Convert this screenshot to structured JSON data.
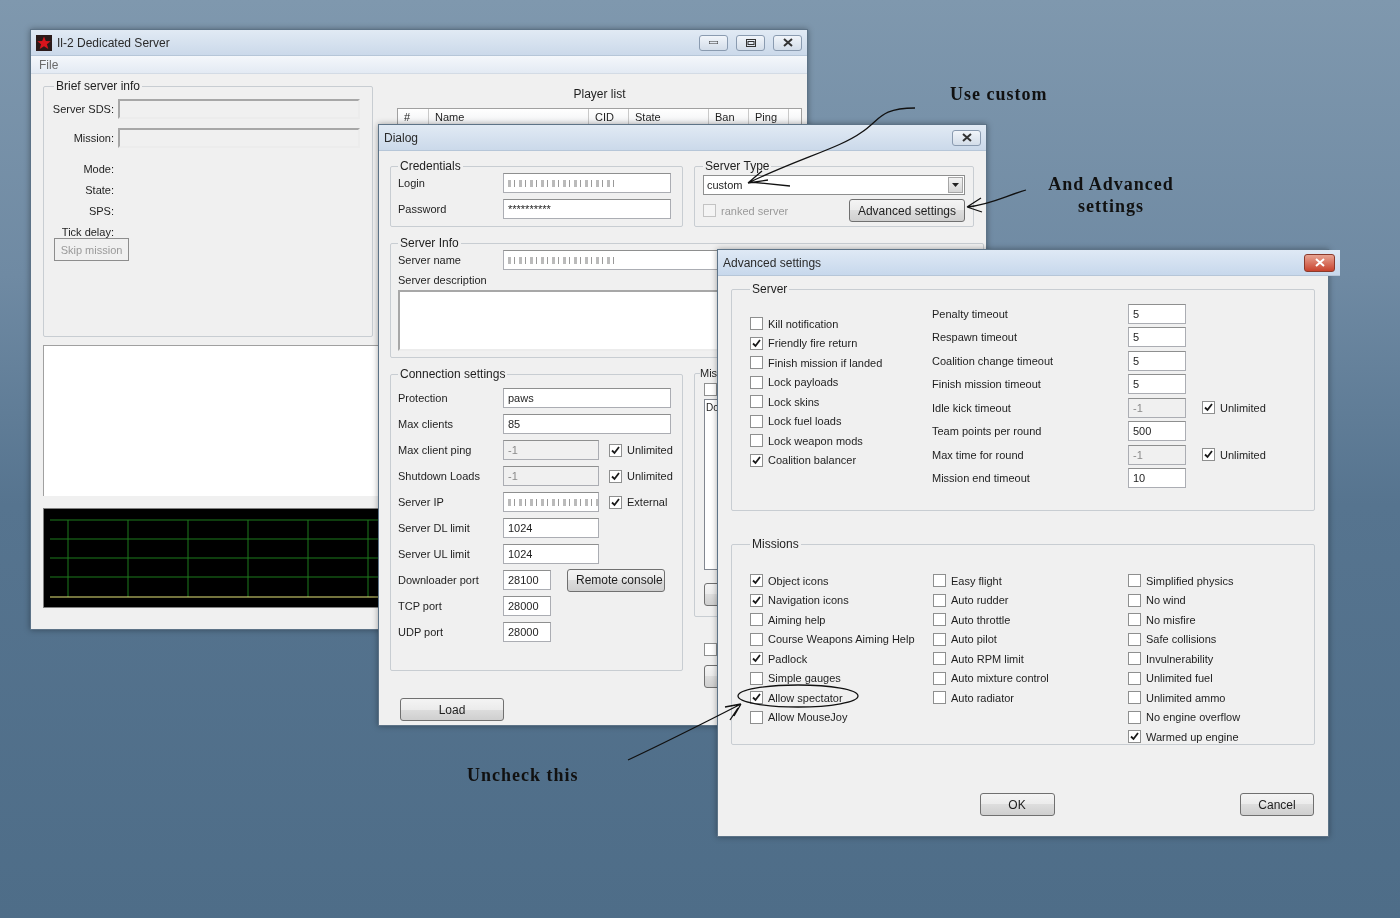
{
  "main_window": {
    "title": "Il-2 Dedicated Server",
    "menu": [
      {
        "label": "File"
      }
    ],
    "brief_info": {
      "title": "Brief server info",
      "rows": [
        {
          "kind": "field",
          "label": "Server SDS:"
        },
        {
          "kind": "field",
          "label": "Mission:"
        },
        {
          "kind": "text",
          "label": "Mode:"
        },
        {
          "kind": "text",
          "label": "State:"
        },
        {
          "kind": "text",
          "label": "SPS:"
        },
        {
          "kind": "text",
          "label": "Tick delay:"
        }
      ],
      "skip_button": {
        "label": "Skip mission",
        "disabled": true
      }
    },
    "player_list": {
      "title": "Player list",
      "columns": [
        "#",
        "Name",
        "CID",
        "State",
        "Ban",
        "Ping"
      ]
    }
  },
  "dialog": {
    "title": "Dialog",
    "credentials": {
      "title": "Credentials",
      "fields": [
        {
          "label": "Login",
          "redacted": true
        },
        {
          "label": "Password",
          "value": "**********",
          "redacted": false
        }
      ]
    },
    "server_type": {
      "title": "Server Type",
      "value": "custom",
      "ranked": {
        "label": "ranked server",
        "checked": false,
        "disabled": true
      },
      "button": "Advanced settings"
    },
    "server_info": {
      "title": "Server Info",
      "name": {
        "label": "Server name",
        "redacted": true
      },
      "description": {
        "label": "Server description"
      }
    },
    "connection": {
      "title": "Connection settings",
      "rows": [
        {
          "label": "Protection",
          "value": "paws",
          "kind": "wide",
          "disabled": false,
          "redacted": false
        },
        {
          "label": "Max clients",
          "value": "85",
          "kind": "wide",
          "disabled": false,
          "redacted": false
        },
        {
          "label": "Max client ping",
          "value": "-1",
          "kind": "medium",
          "disabled": true,
          "redacted": false,
          "check": {
            "label": "Unlimited",
            "checked": true
          }
        },
        {
          "label": "Shutdown Loads",
          "value": "-1",
          "kind": "medium",
          "disabled": true,
          "redacted": false,
          "check": {
            "label": "Unlimited",
            "checked": true
          }
        },
        {
          "label": "Server IP",
          "kind": "medium",
          "disabled": false,
          "redacted": true,
          "check": {
            "label": "External",
            "checked": true
          }
        },
        {
          "label": "Server DL limit",
          "value": "1024",
          "kind": "medium",
          "disabled": false,
          "redacted": false
        },
        {
          "label": "Server UL limit",
          "value": "1024",
          "kind": "medium",
          "disabled": false,
          "redacted": false
        },
        {
          "label": "Downloader port",
          "value": "28100",
          "kind": "short",
          "disabled": false,
          "redacted": false,
          "button": "Remote console"
        },
        {
          "label": "TCP port",
          "value": "28000",
          "kind": "short",
          "disabled": false,
          "redacted": false
        },
        {
          "label": "UDP port",
          "value": "28000",
          "kind": "short",
          "disabled": false,
          "redacted": false
        }
      ]
    },
    "missions_group": {
      "title": "Mis",
      "checked": false,
      "list": [
        "Do"
      ]
    },
    "lower_checkbox": {
      "checked": false
    },
    "load_button": "Load"
  },
  "advanced": {
    "title": "Advanced settings",
    "server": {
      "title": "Server",
      "checks": [
        {
          "label": "Kill notification",
          "checked": false
        },
        {
          "label": "Friendly fire return",
          "checked": true
        },
        {
          "label": "Finish mission if landed",
          "checked": false
        },
        {
          "label": "Lock payloads",
          "checked": false
        },
        {
          "label": "Lock skins",
          "checked": false
        },
        {
          "label": "Lock fuel loads",
          "checked": false
        },
        {
          "label": "Lock weapon mods",
          "checked": false
        },
        {
          "label": "Coalition balancer",
          "checked": true
        }
      ],
      "timeouts": [
        {
          "label": "Penalty timeout",
          "value": "5",
          "disabled": false
        },
        {
          "label": "Respawn timeout",
          "value": "5",
          "disabled": false
        },
        {
          "label": "Coalition change timeout",
          "value": "5",
          "disabled": false
        },
        {
          "label": "Finish mission timeout",
          "value": "5",
          "disabled": false
        },
        {
          "label": "Idle kick timeout",
          "value": "-1",
          "disabled": true,
          "unlimited": {
            "label": "Unlimited",
            "checked": true
          }
        },
        {
          "label": "Team points per round",
          "value": "500",
          "disabled": false
        },
        {
          "label": "Max time for round",
          "value": "-1",
          "disabled": true,
          "unlimited": {
            "label": "Unlimited",
            "checked": true
          }
        },
        {
          "label": "Mission end timeout",
          "value": "10",
          "disabled": false
        }
      ]
    },
    "missions": {
      "title": "Missions",
      "columns": [
        [
          {
            "label": "Object icons",
            "checked": true
          },
          {
            "label": "Navigation icons",
            "checked": true
          },
          {
            "label": "Aiming help",
            "checked": false
          },
          {
            "label": "Course Weapons Aiming Help",
            "checked": false
          },
          {
            "label": "Padlock",
            "checked": true
          },
          {
            "label": "Simple gauges",
            "checked": false
          },
          {
            "label": "Allow spectator",
            "checked": true
          },
          {
            "label": "Allow MouseJoy",
            "checked": false
          }
        ],
        [
          {
            "label": "Easy flight",
            "checked": false
          },
          {
            "label": "Auto rudder",
            "checked": false
          },
          {
            "label": "Auto throttle",
            "checked": false
          },
          {
            "label": "Auto pilot",
            "checked": false
          },
          {
            "label": "Auto RPM limit",
            "checked": false
          },
          {
            "label": "Auto mixture control",
            "checked": false
          },
          {
            "label": "Auto radiator",
            "checked": false
          }
        ],
        [
          {
            "label": "Simplified physics",
            "checked": false
          },
          {
            "label": "No wind",
            "checked": false
          },
          {
            "label": "No misfire",
            "checked": false
          },
          {
            "label": "Safe collisions",
            "checked": false
          },
          {
            "label": "Invulnerability",
            "checked": false
          },
          {
            "label": "Unlimited fuel",
            "checked": false
          },
          {
            "label": "Unlimited ammo",
            "checked": false
          },
          {
            "label": "No engine overflow",
            "checked": false
          },
          {
            "label": "Warmed up engine",
            "checked": true
          }
        ]
      ]
    },
    "buttons": [
      "OK",
      "Cancel"
    ]
  },
  "annotations": [
    {
      "text": "Use custom"
    },
    {
      "text": "And Advanced settings"
    },
    {
      "text": "Uncheck this"
    }
  ]
}
